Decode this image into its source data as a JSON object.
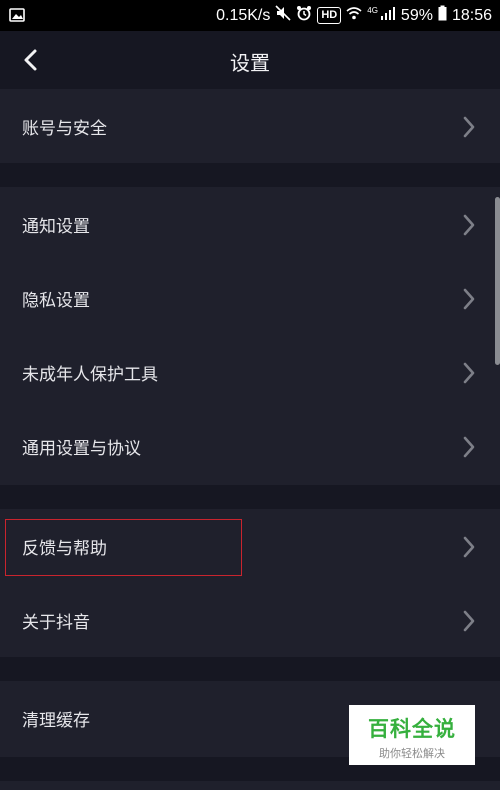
{
  "status_bar": {
    "speed": "0.15K/s",
    "hd": "HD",
    "network": "4G",
    "battery": "59%",
    "time": "18:56"
  },
  "header": {
    "title": "设置"
  },
  "groups": [
    {
      "items": [
        {
          "label": "账号与安全"
        }
      ]
    },
    {
      "items": [
        {
          "label": "通知设置"
        },
        {
          "label": "隐私设置"
        },
        {
          "label": "未成年人保护工具"
        },
        {
          "label": "通用设置与协议"
        }
      ]
    },
    {
      "items": [
        {
          "label": "反馈与帮助"
        },
        {
          "label": "关于抖音"
        }
      ]
    },
    {
      "items": [
        {
          "label": "清理缓存"
        }
      ]
    }
  ],
  "watermark": {
    "title": "百科全说",
    "subtitle": "助你轻松解决"
  },
  "colors": {
    "background": "#161722",
    "row_background": "#1f202c",
    "highlight": "#c9242e",
    "watermark_green": "#36b03e"
  }
}
